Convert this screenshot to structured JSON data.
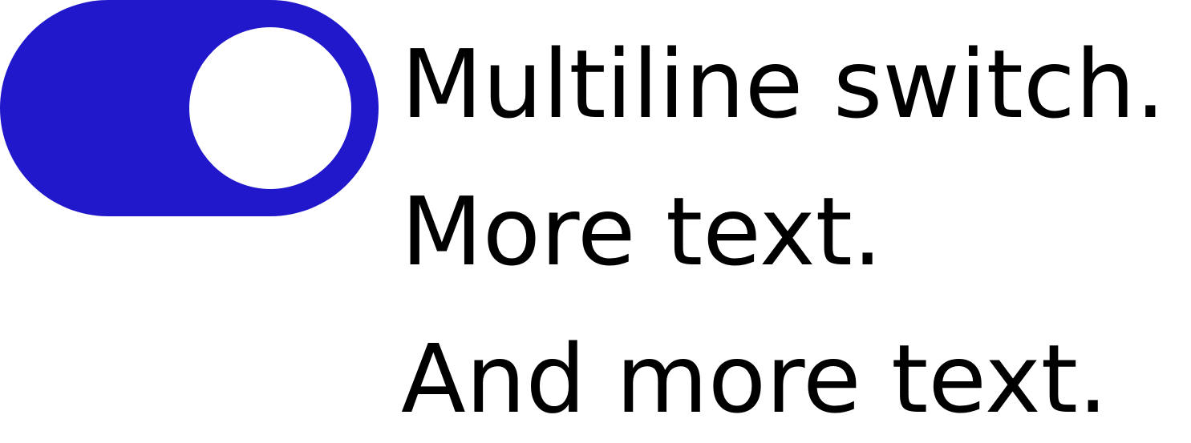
{
  "switch": {
    "checked": true,
    "track_color": "#2117cb",
    "knob_color": "#ffffff"
  },
  "label": {
    "lines": [
      "Multiline switch.",
      "More text.",
      "And more text."
    ]
  }
}
